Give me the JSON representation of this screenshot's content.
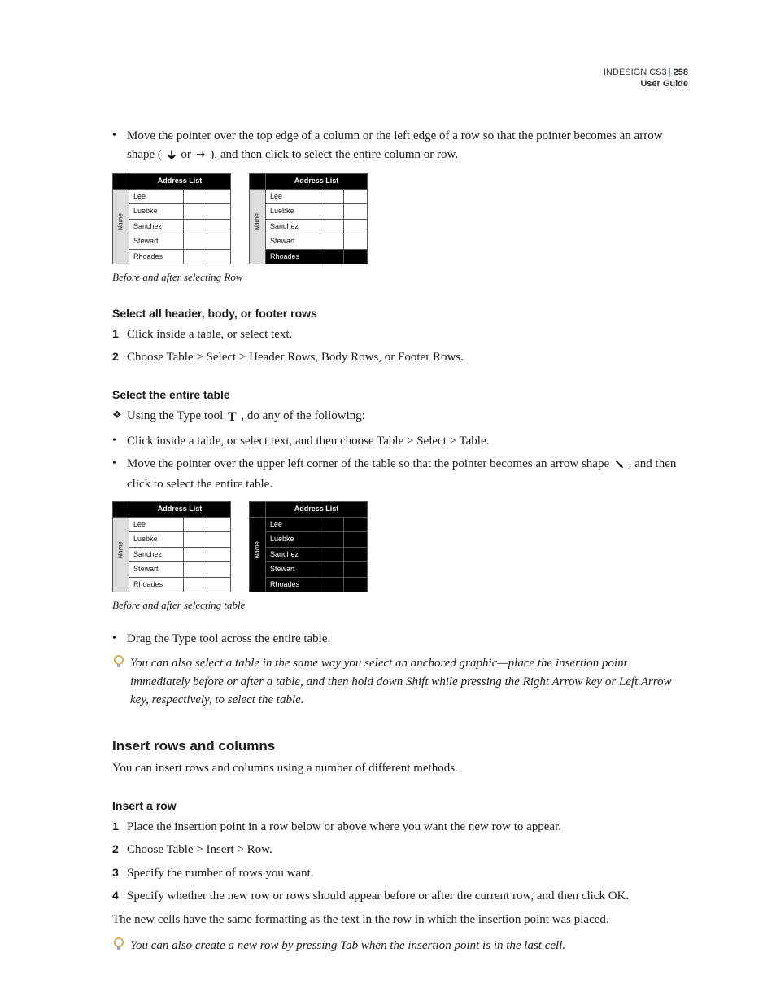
{
  "header": {
    "product": "INDESIGN CS3",
    "page": "258",
    "guide": "User Guide"
  },
  "intro_bullet": {
    "part1": "Move the pointer over the top edge of a column or the left edge of a row so that the pointer becomes an arrow shape (",
    "or": " or ",
    "part2": "), and then click to select the entire column or row."
  },
  "tables": {
    "title": "Address List",
    "side": "Name",
    "rows": [
      "Lee",
      "Luebke",
      "Sanchez",
      "Stewart",
      "Rhoades"
    ]
  },
  "caption1": "Before and after selecting Row",
  "section1": {
    "title": "Select all header, body, or footer rows",
    "step1": "Click inside a table, or select text.",
    "step2": "Choose Table > Select > Header Rows, Body Rows, or Footer Rows."
  },
  "section2": {
    "title": "Select the entire table",
    "lead": "Using the Type tool ",
    "lead2": " , do any of the following:",
    "bullet1": "Click inside a table, or select text, and then choose Table > Select > Table.",
    "bullet2a": "Move the pointer over the upper left corner of the table so that the pointer becomes an arrow shape ",
    "bullet2b": " , and then click to select the entire table."
  },
  "caption2": "Before and after selecting table",
  "bullet_drag": "Drag the Type tool across the entire table.",
  "tip1": "You can also select a table in the same way you select an anchored graphic—place the insertion point immediately before or after a table, and then hold down Shift while pressing the Right Arrow key or Left Arrow key, respectively, to select the table.",
  "h2": "Insert rows and columns",
  "insert_intro": "You can insert rows and columns using a number of different methods.",
  "section3": {
    "title": "Insert a row",
    "step1": "Place the insertion point in a row below or above where you want the new row to appear.",
    "step2": "Choose Table > Insert > Row.",
    "step3": "Specify the number of rows you want.",
    "step4": "Specify whether the new row or rows should appear before or after the current row, and then click OK."
  },
  "after_steps": "The new cells have the same formatting as the text in the row in which the insertion point was placed.",
  "tip2": "You can also create a new row by pressing Tab when the insertion point is in the last cell."
}
